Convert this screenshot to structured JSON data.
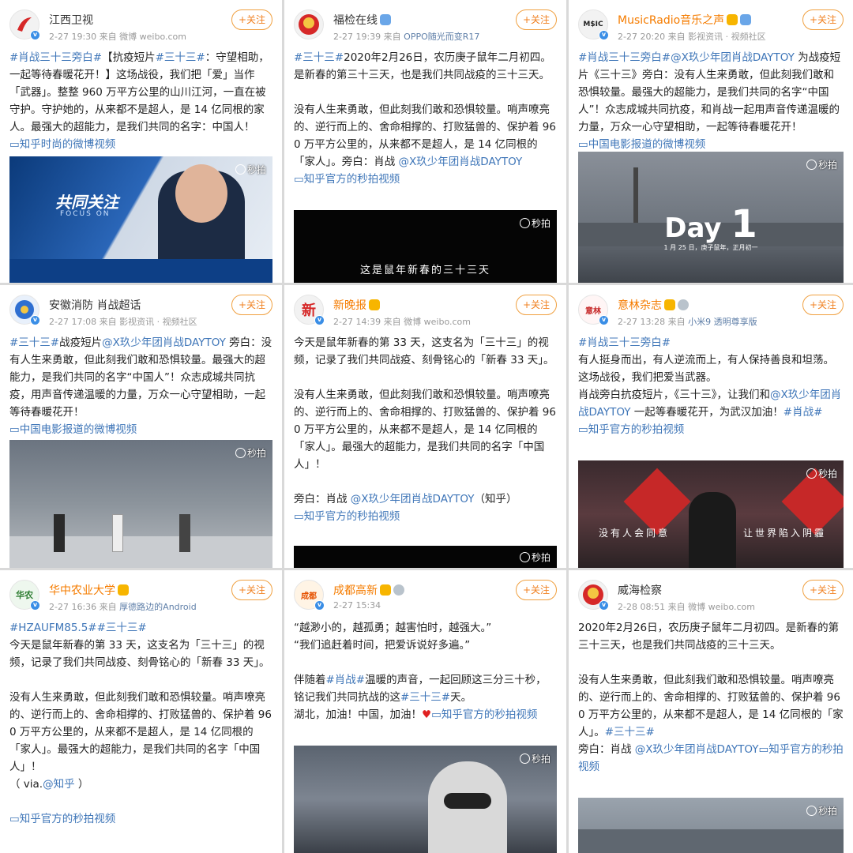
{
  "follow_label": "+关注",
  "miaopai_label": "秒拍",
  "cards": [
    {
      "avatar_text": "江西卫视",
      "name": "江西卫视",
      "time": "2-27 19:30",
      "source_prefix": "来自",
      "source": "微博 weibo.com",
      "text_lines": [
        "#肖战三十三旁白#【抗疫短片#三十三#：守望相助，一起等待春暖花开！】这场战役，我们把「爱」当作「武器」。整整 960 万平方公里的山川江河，一直在被守护。守护她的，从来都不是超人，是 14 亿同根的家人。最强大的超能力，是我们共同的名字：中国人！",
        "知乎时尚的微博视频"
      ],
      "media_subtitle": "共同关注",
      "media_subtitle2": "FOCUS ON"
    },
    {
      "avatar_text": "福检",
      "name": "福检在线",
      "time": "2-27 19:39",
      "source_prefix": "来自",
      "source": "OPPO随光而变R17",
      "text_lines": [
        "#三十三#2020年2月26日，农历庚子鼠年二月初四。是新春的第三十三天，也是我们共同战疫的三十三天。",
        "没有人生来勇敢，但此刻我们敢和恐惧较量。哨声嘹亮的、逆行而上的、舍命相撑的、打败猛兽的、保护着 960 万平方公里的，从来都不是超人，是 14 亿同根的「家人」。旁白：肖战 @X玖少年团肖战DAYTOY ",
        "知乎官方的秒拍视频"
      ],
      "media_subtitle": "这是鼠年新春的三十三天"
    },
    {
      "avatar_text": "MUSIC",
      "name": "MusicRadio音乐之声",
      "time": "2-27 20:20",
      "source_prefix": "来自",
      "source": "影视资讯 · 视频社区",
      "text_lines": [
        "#肖战三十三旁白#@X玖少年团肖战DAYTOY 为战疫短片《三十三》旁白：没有人生来勇敢，但此刻我们敢和恐惧较量。最强大的超能力，是我们共同的名字“中国人”！众志成城共同抗疫，和肖战一起用声音传递温暖的力量，万众一心守望相助，一起等待春暖花开！",
        "中国电影报道的微博视频"
      ],
      "media_day": "Day",
      "media_day_num": "1",
      "media_caption": "1 月 25 日，庚子鼠年，正月初一"
    },
    {
      "avatar_text": "消防",
      "name": "安徽消防",
      "name_suffix": "肖战超话",
      "time": "2-27 17:08",
      "source_prefix": "来自",
      "source": "影视资讯 · 视频社区",
      "text_lines": [
        "#三十三#战疫短片@X玖少年团肖战DAYTOY 旁白：没有人生来勇敢，但此刻我们敢和恐惧较量。最强大的超能力，是我们共同的名字“中国人”！众志成城共同抗疫，用声音传递温暖的力量，万众一心守望相助，一起等待春暖花开！",
        "中国电影报道的微博视频"
      ]
    },
    {
      "avatar_text": "新",
      "name": "新晚报",
      "time": "2-27 14:39",
      "source_prefix": "来自",
      "source": "微博 weibo.com",
      "text_lines": [
        "今天是鼠年新春的第 33 天，这支名为「三十三」的视频，记录了我们共同战疫、刻骨铭心的「新春 33 天」。",
        "没有人生来勇敢，但此刻我们敢和恐惧较量。哨声嘹亮的、逆行而上的、舍命相撑的、打败猛兽的、保护着 960 万平方公里的，从来都不是超人，是 14 亿同根的「家人」。最强大的超能力，是我们共同的名字「中国人」！",
        "旁白：肖战 @X玖少年团肖战DAYTOY（知乎）",
        "知乎官方的秒拍视频"
      ]
    },
    {
      "avatar_text": "意林",
      "name": "意林杂志",
      "time": "2-27 13:28",
      "source_prefix": "来自",
      "source": "小米9 透明尊享版",
      "text_lines": [
        "#肖战三十三旁白#",
        "有人挺身而出，有人逆流而上，有人保持善良和坦荡。这场战役，我们把爱当武器。",
        "肖战旁白抗疫短片，《三十三》，让我们和@X玖少年团肖战DAYTOY 一起等春暖花开，为武汉加油！#肖战#",
        "知乎官方的秒拍视频"
      ],
      "media_sub_left": "没有人会同意",
      "media_sub_right": "让世界陷入阴霾"
    },
    {
      "avatar_text": "华农",
      "name": "华中农业大学",
      "time": "2-27 16:36",
      "source_prefix": "来自",
      "source": "厚德路边的Android",
      "text_lines": [
        "#HZAUFM85.5##三十三#",
        "今天是鼠年新春的第 33 天，这支名为「三十三」的视频，记录了我们共同战疫、刻骨铭心的「新春 33 天」。",
        "没有人生来勇敢，但此刻我们敢和恐惧较量。哨声嘹亮的、逆行而上的、舍命相撑的、打败猛兽的、保护着 960 万平方公里的，从来都不是超人，是 14 亿同根的「家人」。最强大的超能力，是我们共同的名字「中国人」！",
        "（ via.@知乎 ）",
        "知乎官方的秒拍视频"
      ]
    },
    {
      "avatar_text": "成都",
      "name": "成都高新",
      "time": "2-27 15:34",
      "source_prefix": "",
      "source": "",
      "text_lines": [
        "“越渺小的，越孤勇；越害怕时，越强大。”",
        "“我们追赶着时间，把爱诉说好多遍。”",
        "伴随着#肖战#温暖的声音，一起回顾这三分三十秒，铭记我们共同抗战的这#三十三#天。",
        "湖北，加油！中国，加油！",
        "知乎官方的秒拍视频"
      ]
    },
    {
      "avatar_text": "威海",
      "name": "威海检察",
      "time": "2-28 08:51",
      "source_prefix": "来自",
      "source": "微博 weibo.com",
      "text_lines": [
        "2020年2月26日，农历庚子鼠年二月初四。是新春的第三十三天，也是我们共同战疫的三十三天。",
        "没有人生来勇敢，但此刻我们敢和恐惧较量。哨声嘹亮的、逆行而上的、舍命相撑的、打败猛兽的、保护着 960 万平方公里的，从来都不是超人，是 14 亿同根的「家人」。#三十三#",
        "旁白：肖战 @X玖少年团肖战DAYTOY",
        "知乎官方的秒拍视频"
      ]
    }
  ]
}
